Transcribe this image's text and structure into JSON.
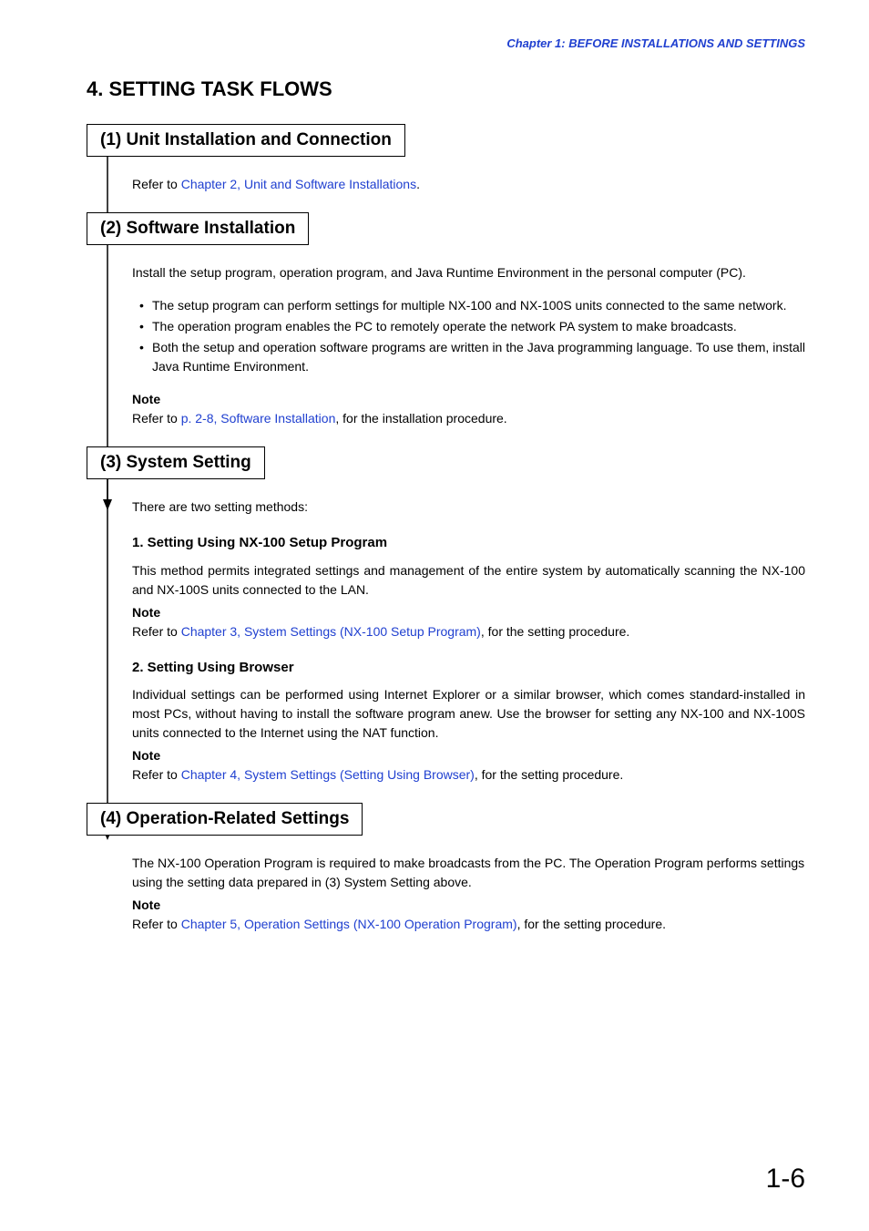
{
  "header": {
    "chapter_line": "Chapter 1:  BEFORE INSTALLATIONS AND SETTINGS"
  },
  "main": {
    "section_title": "4. SETTING TASK FLOWS",
    "steps": [
      {
        "title": "(1) Unit Installation and Connection",
        "refer_prefix": "Refer to ",
        "refer_link": "Chapter 2, Unit and Software Installations",
        "refer_suffix": "."
      },
      {
        "title": "(2) Software Installation",
        "intro": "Install the setup program, operation program, and Java Runtime Environment in the personal computer (PC).",
        "bullets": [
          "The setup program can perform settings for multiple NX-100 and NX-100S units connected to the same network.",
          "The operation program enables the PC to remotely operate the network PA system to make broadcasts.",
          "Both the setup and operation software programs are written in the Java programming language. To use them, install Java Runtime Environment."
        ],
        "note_label": "Note",
        "note_prefix": "Refer to ",
        "note_link": "p. 2-8, Software Installation",
        "note_suffix": ", for the installation procedure."
      },
      {
        "title": "(3) System Setting",
        "intro": "There are two setting methods:",
        "sub1_title": "1. Setting Using NX-100 Setup Program",
        "sub1_body": "This method permits integrated settings and management of the entire system by automatically scanning the NX-100 and NX-100S units connected to the LAN.",
        "sub1_note_label": "Note",
        "sub1_note_prefix": "Refer to ",
        "sub1_note_link": "Chapter 3, System Settings (NX-100 Setup Program)",
        "sub1_note_suffix": ", for the setting procedure.",
        "sub2_title": "2. Setting Using Browser",
        "sub2_body": "Individual settings can be performed using Internet Explorer or a similar browser, which comes standard-installed in most PCs, without having to install the software program anew. Use the browser for setting any NX-100 and NX-100S units connected to the Internet using the NAT function.",
        "sub2_note_label": "Note",
        "sub2_note_prefix": "Refer to ",
        "sub2_note_link": "Chapter 4, System Settings (Setting Using Browser)",
        "sub2_note_suffix": ", for the setting procedure."
      },
      {
        "title": "(4) Operation-Related Settings",
        "body": "The NX-100 Operation Program is required to make broadcasts from the PC. The Operation Program performs settings using the setting data prepared in (3) System Setting above.",
        "note_label": "Note",
        "note_prefix": "Refer to ",
        "note_link": "Chapter 5, Operation Settings (NX-100 Operation Program)",
        "note_suffix": ", for the setting procedure."
      }
    ]
  },
  "page_number": "1-6"
}
